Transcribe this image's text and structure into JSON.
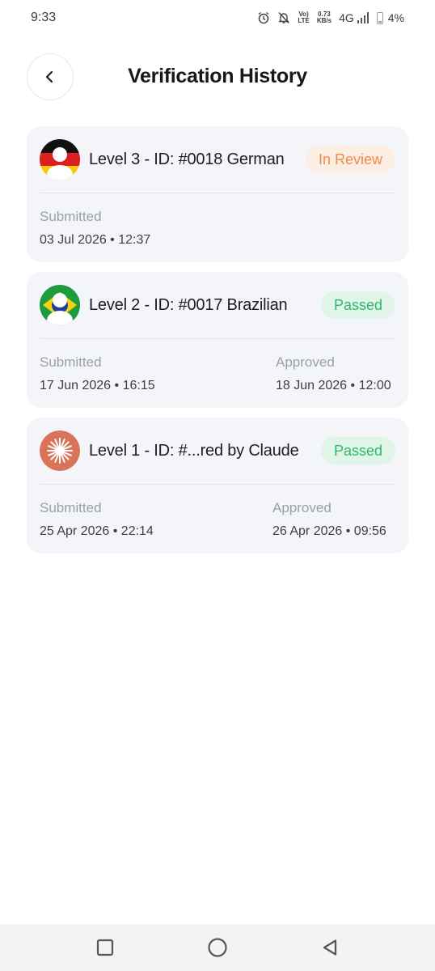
{
  "status_bar": {
    "time": "9:33",
    "net_speed_top": "0.73",
    "net_speed_bottom": "KB/s",
    "volte_top": "Vo)",
    "volte_bottom": "LTE",
    "network": "4G",
    "battery": "4%",
    "icons": [
      "alarm-icon",
      "bell-off-icon",
      "signal-icon",
      "battery-icon"
    ]
  },
  "header": {
    "title": "Verification History",
    "back_icon": "chevron-left-icon"
  },
  "cards": [
    {
      "title": "Level 3 - ID: #0018 German",
      "avatar": "german-flag-avatar",
      "status": "In Review",
      "submitted_label": "Submitted",
      "submitted_value": "03 Jul 2026 • 12:37"
    },
    {
      "title": "Level 2 - ID: #0017 Brazilian",
      "avatar": "brazilian-flag-avatar",
      "status": "Passed",
      "submitted_label": "Submitted",
      "submitted_value": "17 Jun 2026 • 16:15",
      "approved_label": "Approved",
      "approved_value": "18 Jun 2026 • 12:00"
    },
    {
      "title": "Level 1 - ID: #...red by Claude",
      "avatar": "claude-logo-avatar",
      "status": "Passed",
      "submitted_label": "Submitted",
      "submitted_value": "25 Apr 2026 • 22:14",
      "approved_label": "Approved",
      "approved_value": "26 Apr 2026 • 09:56"
    }
  ],
  "colors": {
    "card_bg": "#f4f5f9",
    "review_bg": "#fdeee4",
    "review_text": "#f08a4b",
    "passed_bg": "#dff5e8",
    "passed_text": "#2fb86a"
  },
  "nav_bar": {
    "icons": [
      "recents-square-icon",
      "home-circle-icon",
      "back-triangle-icon"
    ]
  }
}
